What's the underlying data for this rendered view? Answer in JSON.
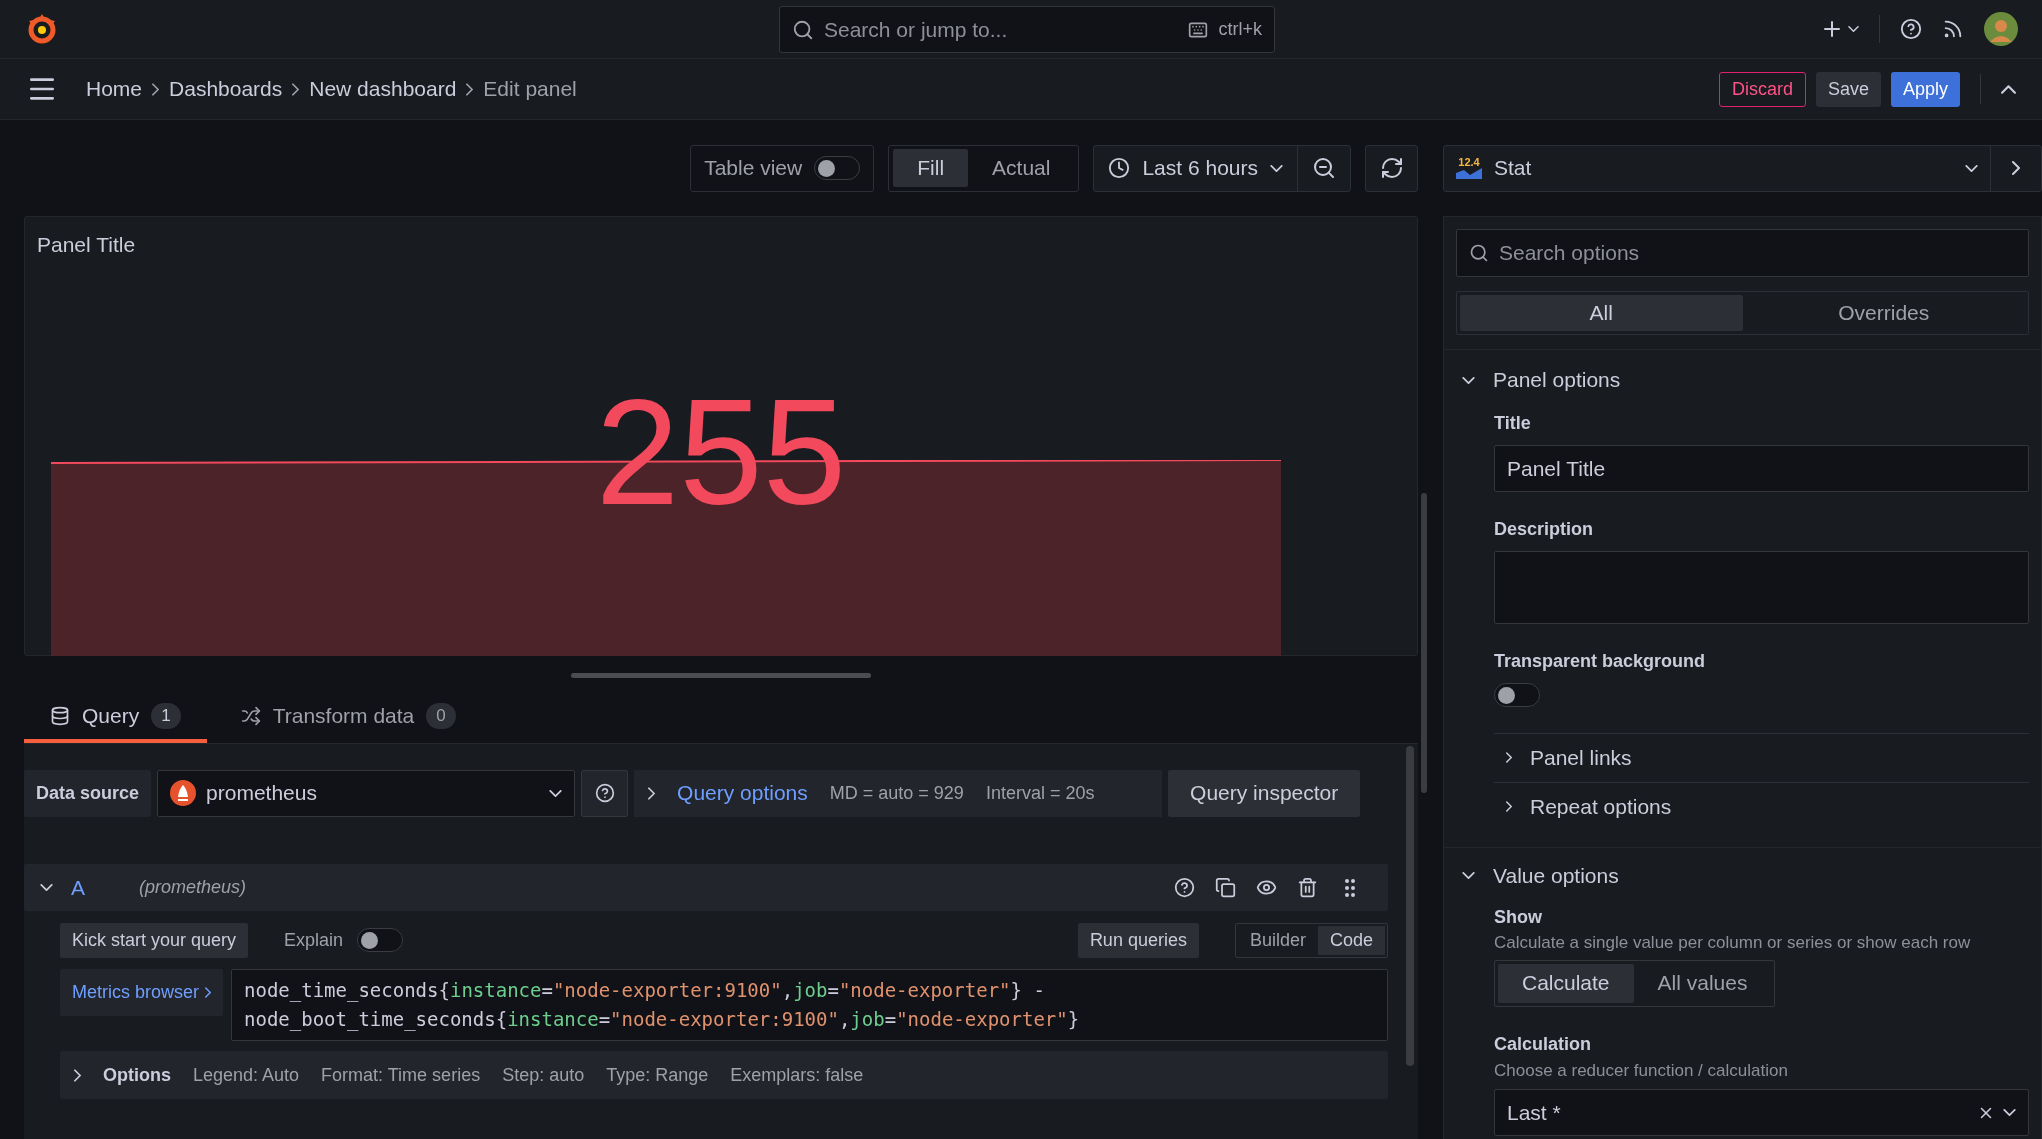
{
  "topbar": {
    "search_placeholder": "Search or jump to...",
    "shortcut": "ctrl+k"
  },
  "breadcrumbs": [
    {
      "label": "Home",
      "current": false
    },
    {
      "label": "Dashboards",
      "current": false
    },
    {
      "label": "New dashboard",
      "current": false
    },
    {
      "label": "Edit panel",
      "current": true
    }
  ],
  "actions": [
    {
      "label": "Discard",
      "kind": "danger"
    },
    {
      "label": "Save",
      "kind": "secondary"
    },
    {
      "label": "Apply",
      "kind": "primary"
    }
  ],
  "toolbar": {
    "table_view": {
      "label": "Table view",
      "on": false
    },
    "size_modes": [
      {
        "label": "Fill",
        "selected": true
      },
      {
        "label": "Actual",
        "selected": false
      }
    ],
    "time_range": "Last 6 hours"
  },
  "viz_picker": {
    "icon_text": "12.4",
    "label": "Stat"
  },
  "panel": {
    "title": "Panel Title",
    "value": "255"
  },
  "query_tabs": [
    {
      "label": "Query",
      "count": "1",
      "selected": true,
      "kind": "query"
    },
    {
      "label": "Transform data",
      "count": "0",
      "selected": false,
      "kind": "transform"
    }
  ],
  "data_source": {
    "label": "Data source",
    "value": "prometheus",
    "query_options": "Query options",
    "md": "MD = auto = 929",
    "interval": "Interval = 20s",
    "inspector": "Query inspector"
  },
  "query": {
    "ref": "A",
    "source": "(prometheus)",
    "expanded": true,
    "kick_start": "Kick start your query",
    "explain": {
      "label": "Explain",
      "on": false
    },
    "run": "Run queries",
    "modes": [
      {
        "label": "Builder",
        "selected": false
      },
      {
        "label": "Code",
        "selected": true
      }
    ],
    "metrics_browser": "Metrics browser",
    "code_lines": [
      [
        {
          "kind": "metric",
          "text": "node_time_seconds{"
        },
        {
          "kind": "label",
          "text": "instance"
        },
        {
          "kind": "punct",
          "text": "="
        },
        {
          "kind": "string",
          "text": "\"node-exporter:9100\""
        },
        {
          "kind": "punct",
          "text": ","
        },
        {
          "kind": "label",
          "text": "job"
        },
        {
          "kind": "punct",
          "text": "="
        },
        {
          "kind": "string",
          "text": "\"node-exporter\""
        },
        {
          "kind": "metric",
          "text": "} -"
        }
      ],
      [
        {
          "kind": "metric",
          "text": "node_boot_time_seconds{"
        },
        {
          "kind": "label",
          "text": "instance"
        },
        {
          "kind": "punct",
          "text": "="
        },
        {
          "kind": "string",
          "text": "\"node-exporter:9100\""
        },
        {
          "kind": "punct",
          "text": ","
        },
        {
          "kind": "label",
          "text": "job"
        },
        {
          "kind": "punct",
          "text": "="
        },
        {
          "kind": "string",
          "text": "\"node-exporter\""
        },
        {
          "kind": "metric",
          "text": "}"
        }
      ]
    ],
    "options": {
      "label": "Options",
      "expanded": false,
      "items": [
        "Legend: Auto",
        "Format: Time series",
        "Step: auto",
        "Type: Range",
        "Exemplars: false"
      ]
    }
  },
  "options_pane": {
    "search_placeholder": "Search options",
    "tabs": [
      {
        "label": "All",
        "selected": true
      },
      {
        "label": "Overrides",
        "selected": false
      }
    ],
    "panel_options": {
      "title": "Panel options",
      "expanded": true,
      "title_label": "Title",
      "title_value": "Panel Title",
      "description_label": "Description",
      "transparent": {
        "label": "Transparent background",
        "on": false
      },
      "sections": [
        {
          "label": "Panel links",
          "expanded": false
        },
        {
          "label": "Repeat options",
          "expanded": false
        }
      ]
    },
    "value_options": {
      "title": "Value options",
      "expanded": true,
      "show_label": "Show",
      "show_description": "Calculate a single value per column or series or show each row",
      "show_modes": [
        {
          "label": "Calculate",
          "selected": true
        },
        {
          "label": "All values",
          "selected": false
        }
      ],
      "calculation_label": "Calculation",
      "calculation_description": "Choose a reducer function / calculation",
      "calculation_value": "Last *"
    }
  }
}
